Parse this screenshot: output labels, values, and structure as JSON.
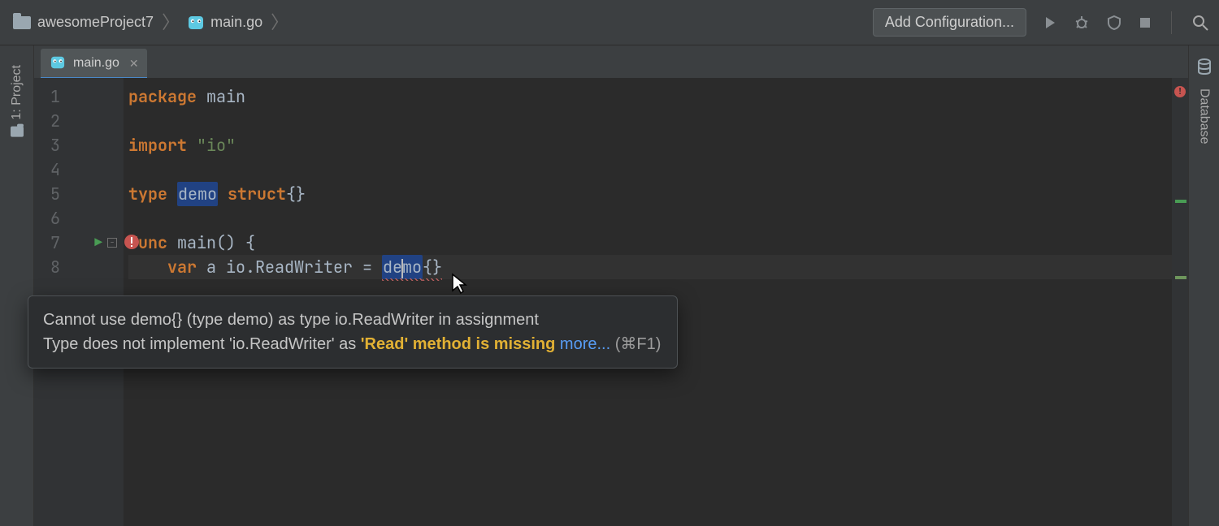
{
  "breadcrumb": {
    "project": "awesomeProject7",
    "file": "main.go"
  },
  "toolbar": {
    "add_config_label": "Add Configuration..."
  },
  "left_strip": {
    "project_label": "1: Project"
  },
  "right_strip": {
    "database_label": "Database"
  },
  "tab": {
    "label": "main.go"
  },
  "code": {
    "lines": [
      "1",
      "2",
      "3",
      "4",
      "5",
      "6",
      "7",
      "8"
    ],
    "l1_kw": "package",
    "l1_sp": " ",
    "l1_id": "main",
    "l3_kw": "import",
    "l3_sp": " ",
    "l3_str": "\"io\"",
    "l5_kw1": "type",
    "l5_sp1": " ",
    "l5_id": "demo",
    "l5_sp2": " ",
    "l5_kw2": "struct",
    "l5_pu": "{}",
    "l7_kw": "func",
    "l7_sp": " ",
    "l7_id": "main",
    "l7_pu": "() {",
    "l8_indent": "    ",
    "l8_kw": "var",
    "l8_sp1": " ",
    "l8_a": "a",
    "l8_sp2": " ",
    "l8_io": "io",
    "l8_dot": ".ReadWriter = ",
    "l8_demo_pre": "de",
    "l8_demo_post": "mo",
    "l8_suffix": "{}"
  },
  "tooltip": {
    "line1": "Cannot use demo{} (type demo) as type io.ReadWriter in assignment",
    "line2_prefix": "Type does not implement 'io.ReadWriter' as ",
    "line2_strong": "'Read' method is missing",
    "more": "more...",
    "shortcut": " (⌘F1)"
  }
}
